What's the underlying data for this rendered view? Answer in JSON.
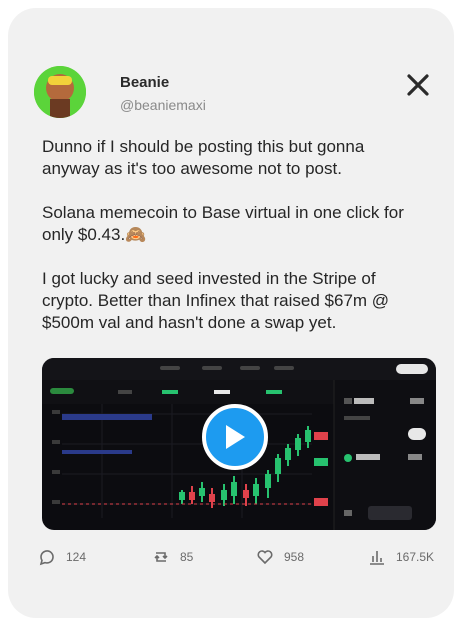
{
  "author": {
    "name": "Beanie",
    "handle": "@beaniemaxi"
  },
  "post": {
    "paragraphs": [
      "Dunno if I should be posting this but gonna anyway as it's too awesome not to post.",
      "Solana memecoin to Base virtual in one click for only $0.43.🙈",
      "I got lucky and seed invested in the Stripe of crypto. Better than Infinex that raised $67m @ $500m val and hasn't done a swap yet."
    ]
  },
  "metrics": {
    "replies": "124",
    "reposts": "85",
    "likes": "958",
    "views": "167.5K"
  },
  "icons": {
    "platform": "x-logo-icon",
    "media_action": "play-icon"
  },
  "colors": {
    "card_background": "#f1f1f1",
    "play_button": "#1d9bf0",
    "candle_up": "#27c26f",
    "candle_down": "#e0424b"
  }
}
